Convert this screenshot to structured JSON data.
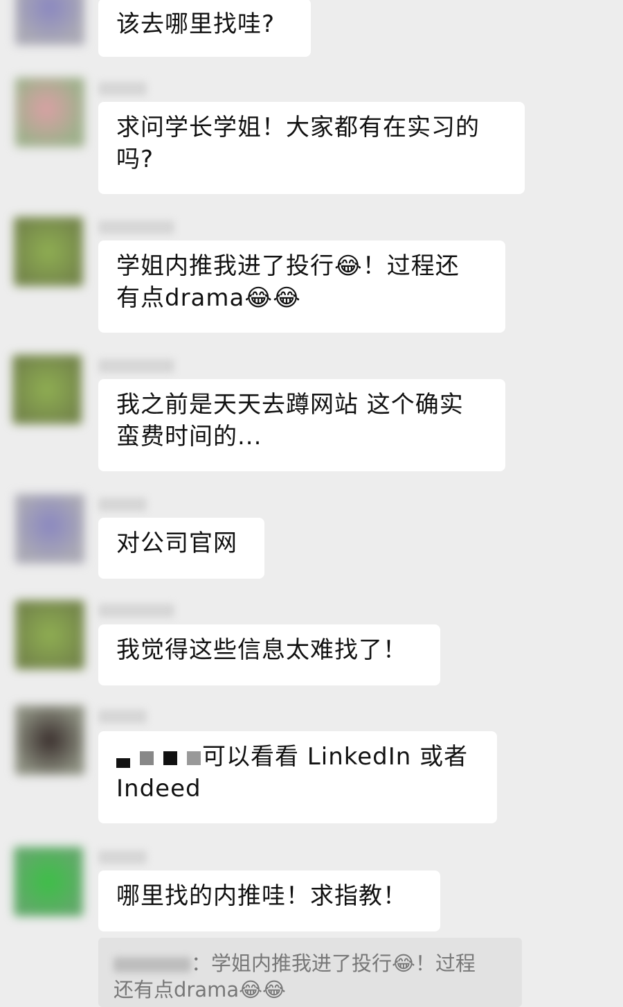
{
  "messages": [
    {
      "text_lines": [
        "该去哪里找哇?"
      ]
    },
    {
      "text_lines": [
        "求问学长学姐！大家都有在实习的",
        "吗?"
      ]
    },
    {
      "text_lines": [
        "学姐内推我进了投行😂！过程还",
        "有点drama😂😂"
      ]
    },
    {
      "text_lines": [
        "我之前是天天去蹲网站 这个确实",
        "蛮费时间的..."
      ]
    },
    {
      "text_lines": [
        "对公司官网"
      ]
    },
    {
      "text_lines": [
        "我觉得这些信息太难找了！"
      ]
    },
    {
      "text_lines": [
        "可以看看 LinkedIn 或者",
        "Indeed"
      ]
    },
    {
      "text_lines": [
        "哪里找的内推哇！求指教！"
      ]
    }
  ],
  "quote": {
    "separator": "：",
    "line1": "学姐内推我进了投行😂！过程",
    "line2": "还有点drama😂😂"
  },
  "colors": {
    "background": "#ededed",
    "bubble": "#ffffff",
    "quote_bg": "#e2e2e2"
  }
}
